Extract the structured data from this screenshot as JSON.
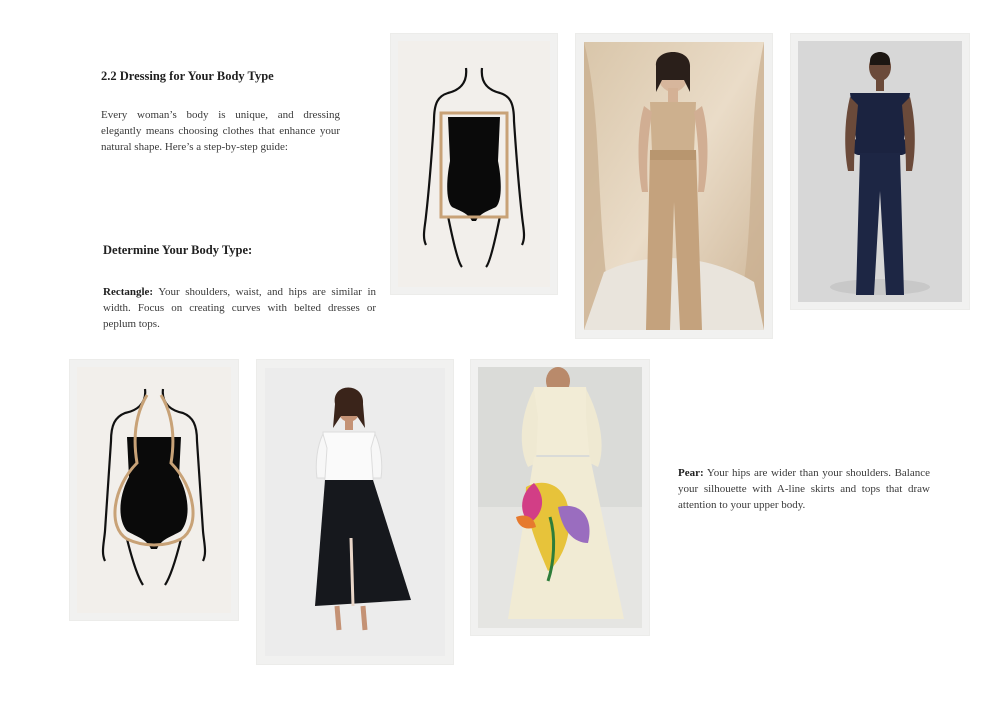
{
  "section": {
    "title": "2.2 Dressing for Your Body Type",
    "intro": "Every woman’s body is unique, and dressing elegantly means choosing clothes that enhance your natural shape. Here’s a step-by-step guide:",
    "subheading": "Determine Your Body Type:"
  },
  "body_types": {
    "rectangle": {
      "label": "Rectangle:",
      "text": "Your shoulders, waist, and hips are similar in width. Focus on creating curves with belted dresses or peplum tops."
    },
    "pear": {
      "label": "Pear:",
      "text": "Your hips are wider than your shoulders. Balance your silhouette with A-line skirts and tops that draw attention to your upper body."
    }
  },
  "images": {
    "rectangle_illustration": "rectangle-body-shape-illustration",
    "beige_outfit_photo": "woman-in-beige-top-and-wide-leg-trousers",
    "navy_outfit_photo": "woman-in-navy-peplum-top-and-wide-leg-pants",
    "pear_illustration": "pear-body-shape-illustration",
    "skirt_outfit_photo": "woman-in-white-shirt-and-black-a-line-skirt",
    "floral_dress_photo": "woman-in-cream-dress-with-floral-print-skirt"
  },
  "colors": {
    "frame": "#f1f1f0",
    "illustration_bg": "#f2efeb",
    "shape_outline": "#c8a277",
    "ink": "#111111"
  }
}
